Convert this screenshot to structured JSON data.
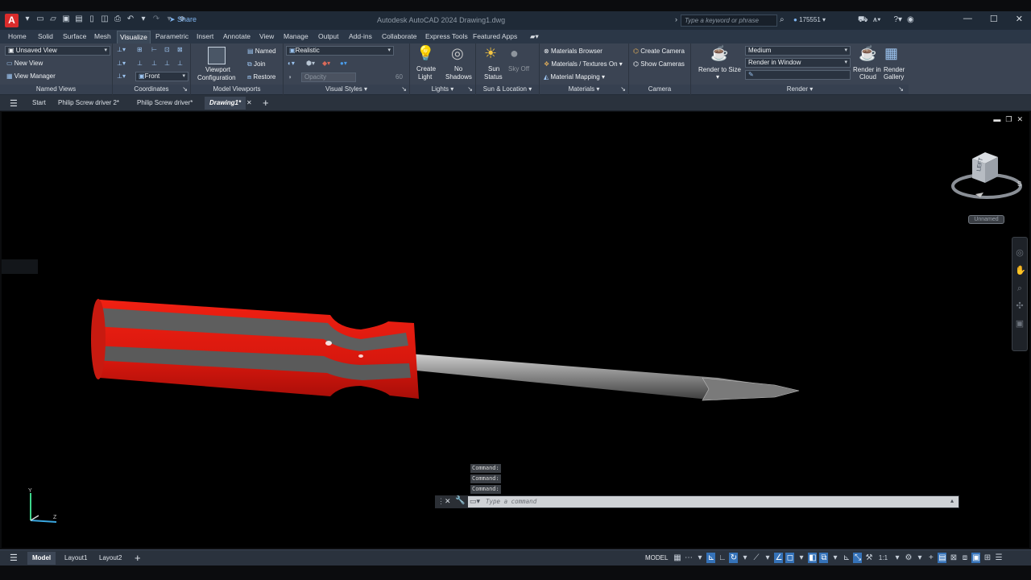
{
  "titlebar": {
    "app_letter": "A",
    "share": "Share",
    "title": "Autodesk AutoCAD 2024    Drawing1.dwg",
    "search_placeholder": "Type a keyword or phrase",
    "user": "175551"
  },
  "ribbon_tabs": [
    "Home",
    "Solid",
    "Surface",
    "Mesh",
    "Visualize",
    "Parametric",
    "Insert",
    "Annotate",
    "View",
    "Manage",
    "Output",
    "Add-ins",
    "Collaborate",
    "Express Tools",
    "Featured Apps"
  ],
  "active_tab": "Visualize",
  "panels": {
    "named_views": {
      "title": "Named Views",
      "view_select": "Unsaved View",
      "new_view": "New View",
      "view_manager": "View Manager"
    },
    "coordinates": {
      "title": "Coordinates",
      "ucs_select": "Front"
    },
    "model_viewports": {
      "title": "Model Viewports",
      "config": "Viewport",
      "config2": "Configuration",
      "named": "Named",
      "join": "Join",
      "restore": "Restore"
    },
    "visual_styles": {
      "title": "Visual Styles",
      "style": "Realistic",
      "opacity": "Opacity",
      "opacity_value": "60"
    },
    "lights": {
      "title": "Lights",
      "create_light": "Create",
      "create_light2": "Light",
      "no_shadows": "No",
      "no_shadows2": "Shadows"
    },
    "sun": {
      "title": "Sun & Location",
      "sun_status": "Sun",
      "sun_status2": "Status",
      "sky_off": "Sky Off"
    },
    "materials": {
      "title": "Materials",
      "browser": "Materials Browser",
      "textures": "Materials / Textures On",
      "mapping": "Material Mapping"
    },
    "camera": {
      "title": "Camera",
      "create": "Create Camera",
      "show": "Show  Cameras"
    },
    "render": {
      "title": "Render",
      "render_size": "Render to Size",
      "quality": "Medium",
      "output": "Render in Window",
      "cloud": "Render in",
      "cloud2": "Cloud",
      "gallery": "Render",
      "gallery2": "Gallery"
    }
  },
  "doc_tabs": [
    "Start",
    "Philip Screw driver 2*",
    "Philip Screw driver*",
    "Drawing1*"
  ],
  "viewcube": {
    "face": "LEFT",
    "compass_s": "S",
    "unnamed": "Unnamed"
  },
  "command": {
    "history": [
      "Command:",
      "Command:",
      "Command:"
    ],
    "placeholder": "Type  a  command"
  },
  "layouts": [
    "Model",
    "Layout1",
    "Layout2"
  ],
  "status": {
    "model": "MODEL",
    "scale": "1:1"
  },
  "colors": {
    "handle_red": "#e01a10",
    "grip_gray": "#606060",
    "shaft": "#8a8a8a",
    "accent": "#3572b8"
  }
}
